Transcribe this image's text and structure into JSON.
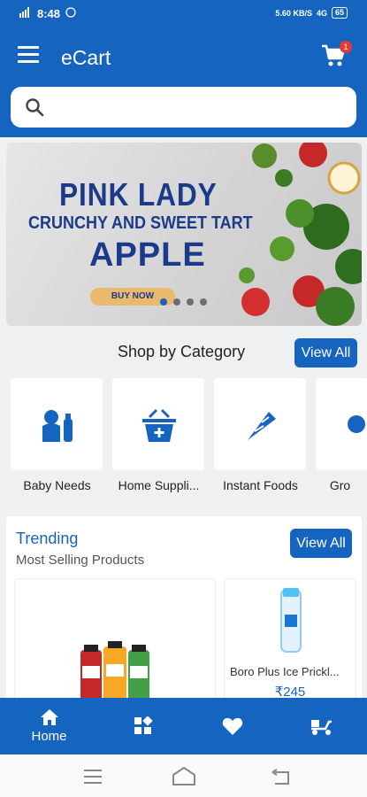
{
  "status": {
    "time": "8:48",
    "network": "5.60",
    "net_unit": "KB/S",
    "signal": "4G",
    "battery": "65"
  },
  "appbar": {
    "title": "eCart",
    "cart_count": "1"
  },
  "search": {
    "placeholder": "",
    "value": ""
  },
  "banner": {
    "line1": "PINK LADY",
    "line2": "CRUNCHY AND SWEET TART",
    "line3": "APPLE",
    "cta": "BUY NOW",
    "slides": 4,
    "active_slide": 0
  },
  "categories": {
    "title": "Shop by Category",
    "view_all": "View All",
    "items": [
      {
        "label": "Baby Needs",
        "icon": "baby-bottle-icon"
      },
      {
        "label": "Home Suppli...",
        "icon": "basket-icon"
      },
      {
        "label": "Instant Foods",
        "icon": "food-cone-icon"
      },
      {
        "label": "Gro",
        "icon": "grocery-icon"
      }
    ]
  },
  "trending": {
    "title": "Trending",
    "subtitle": "Most Selling Products",
    "view_all": "View All",
    "products": [
      {
        "name": "",
        "price": "",
        "image": "juice-bottles"
      },
      {
        "name": "Boro Plus Ice Prickl...",
        "price": "₹245",
        "image": "talc-bottle"
      }
    ]
  },
  "bottom_nav": {
    "items": [
      {
        "label": "Home",
        "icon": "home-icon",
        "active": true
      },
      {
        "label": "",
        "icon": "categories-icon",
        "active": false
      },
      {
        "label": "",
        "icon": "heart-icon",
        "active": false
      },
      {
        "label": "",
        "icon": "delivery-scooter-icon",
        "active": false
      }
    ]
  },
  "colors": {
    "primary": "#1565c0",
    "badge": "#e53935",
    "banner_text": "#1c3a8a",
    "cta": "#e9b96e"
  }
}
